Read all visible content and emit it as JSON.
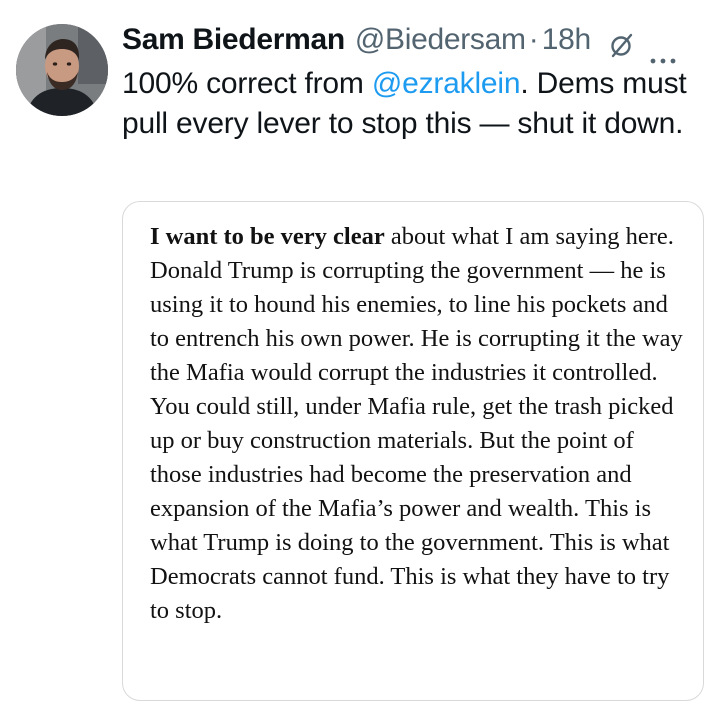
{
  "tweet": {
    "author": {
      "display_name": "Sam Biederman",
      "handle": "@Biedersam",
      "separator": "·",
      "time": "18h",
      "avatar_icon": "avatar-photo"
    },
    "header_icons": {
      "grok": "grok-icon",
      "more": "more-options-icon"
    },
    "text": {
      "lead": "100% correct from ",
      "mention": "@ezraklein",
      "rest": ". Dems must pull every lever to stop this — shut it down."
    },
    "quote": {
      "bold_lead": "I want to be very clear",
      "body": " about what I am saying here. Donald Trump is corrupting the government — he is using it to hound his enemies, to line his pockets and to entrench his own power. He is corrupting it the way the Mafia would corrupt the industries it controlled. You could still, under Mafia rule, get the trash picked up or buy construction materials. But the point of those industries had become the preservation and expansion of the Mafia’s power and wealth. This is what Trump is doing to the government. This is what Democrats cannot fund. This is what they have to try to stop."
    },
    "colors": {
      "text": "#0f1419",
      "secondary": "#536471",
      "link": "#1d9bf0",
      "card_border": "#d9d9d9"
    }
  }
}
